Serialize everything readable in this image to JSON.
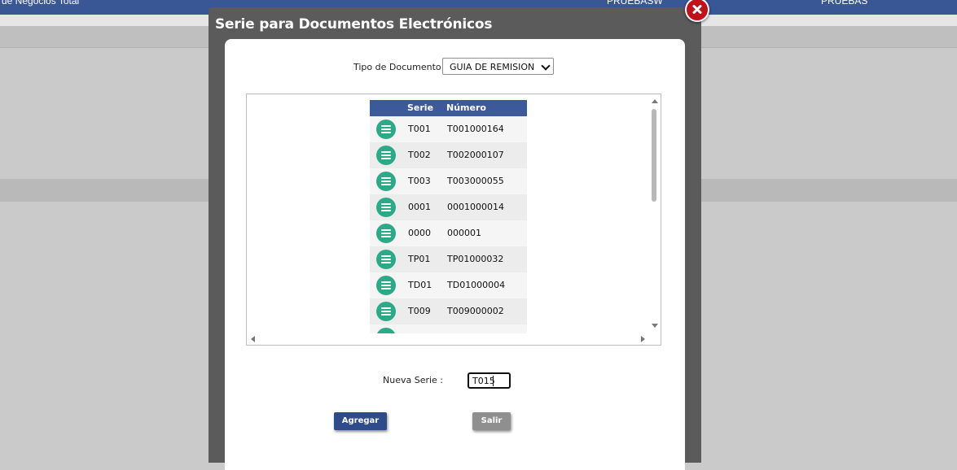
{
  "background": {
    "topbar_left_text": "de Negocios Total",
    "topbar_mid_text": "PRUEBASW",
    "topbar_right_text": "PRUEBAS"
  },
  "dialog": {
    "title": "Serie para Documentos Electrónicos",
    "close_icon": "close-x-icon",
    "doc_type_label": "Tipo de Documento :",
    "doc_type_selected": "GUIA DE REMISION",
    "table": {
      "columns": [
        "Serie",
        "Número"
      ],
      "row_icon": "menu-lines-icon",
      "rows": [
        {
          "serie": "T001",
          "numero": "T001000164"
        },
        {
          "serie": "T002",
          "numero": "T002000107"
        },
        {
          "serie": "T003",
          "numero": "T003000055"
        },
        {
          "serie": "0001",
          "numero": "0001000014"
        },
        {
          "serie": "0000",
          "numero": "000001"
        },
        {
          "serie": "TP01",
          "numero": "TP01000032"
        },
        {
          "serie": "TD01",
          "numero": "TD01000004"
        },
        {
          "serie": "T009",
          "numero": "T009000002"
        },
        {
          "serie": "",
          "numero": ""
        }
      ]
    },
    "new_serie_label": "Nueva Serie :",
    "new_serie_value": "T015",
    "add_button": "Agregar",
    "exit_button": "Salir"
  },
  "colors": {
    "header_blue": "#3c5a99",
    "icon_green": "#2aaa86",
    "close_red": "#c1121a",
    "modal_gray": "#5b5b5b"
  }
}
